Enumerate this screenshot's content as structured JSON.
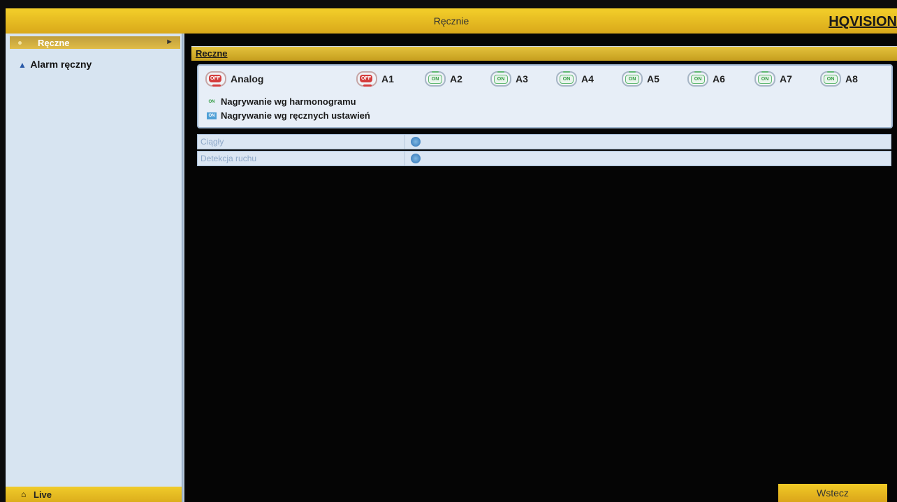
{
  "window": {
    "title": "Ręcznie",
    "brand": "HQVISION"
  },
  "sidebar": {
    "active_item": {
      "label": "Ręczne"
    },
    "items": [
      {
        "label": "Alarm ręczny"
      }
    ],
    "bottom": {
      "label": "Live"
    }
  },
  "main": {
    "section_tab": "Reczne",
    "channels": [
      {
        "label": "Analog",
        "state": "OFF"
      },
      {
        "label": "A1",
        "state": "OFF"
      },
      {
        "label": "A2",
        "state": "ON"
      },
      {
        "label": "A3",
        "state": "ON"
      },
      {
        "label": "A4",
        "state": "ON"
      },
      {
        "label": "A5",
        "state": "ON"
      },
      {
        "label": "A6",
        "state": "ON"
      },
      {
        "label": "A7",
        "state": "ON"
      },
      {
        "label": "A8",
        "state": "ON"
      }
    ],
    "legend": [
      {
        "icon_text": "ON",
        "label": "Nagrywanie wg harmonogramu"
      },
      {
        "icon_text": "ON",
        "label": "Nagrywanie wg ręcznych ustawień"
      }
    ],
    "rows": [
      {
        "label": "Ciągły"
      },
      {
        "label": "Detekcja ruchu"
      }
    ],
    "back_button": "Wstecz"
  }
}
